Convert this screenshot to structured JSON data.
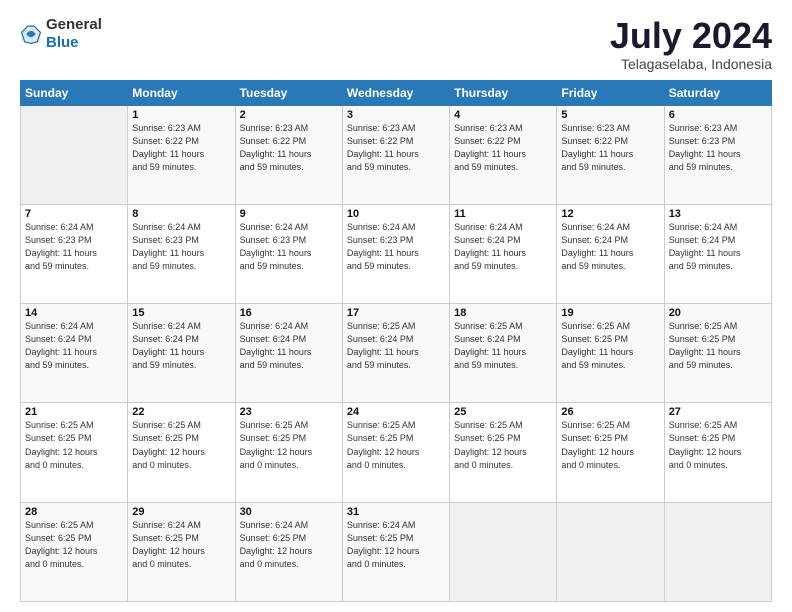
{
  "header": {
    "logo": {
      "general": "General",
      "blue": "Blue"
    },
    "title": "July 2024",
    "subtitle": "Telagaselaba, Indonesia"
  },
  "calendar": {
    "weekdays": [
      "Sunday",
      "Monday",
      "Tuesday",
      "Wednesday",
      "Thursday",
      "Friday",
      "Saturday"
    ],
    "weeks": [
      [
        {
          "day": "",
          "info": ""
        },
        {
          "day": "1",
          "info": "Sunrise: 6:23 AM\nSunset: 6:22 PM\nDaylight: 11 hours\nand 59 minutes."
        },
        {
          "day": "2",
          "info": "Sunrise: 6:23 AM\nSunset: 6:22 PM\nDaylight: 11 hours\nand 59 minutes."
        },
        {
          "day": "3",
          "info": "Sunrise: 6:23 AM\nSunset: 6:22 PM\nDaylight: 11 hours\nand 59 minutes."
        },
        {
          "day": "4",
          "info": "Sunrise: 6:23 AM\nSunset: 6:22 PM\nDaylight: 11 hours\nand 59 minutes."
        },
        {
          "day": "5",
          "info": "Sunrise: 6:23 AM\nSunset: 6:22 PM\nDaylight: 11 hours\nand 59 minutes."
        },
        {
          "day": "6",
          "info": "Sunrise: 6:23 AM\nSunset: 6:23 PM\nDaylight: 11 hours\nand 59 minutes."
        }
      ],
      [
        {
          "day": "7",
          "info": "Sunrise: 6:24 AM\nSunset: 6:23 PM\nDaylight: 11 hours\nand 59 minutes."
        },
        {
          "day": "8",
          "info": "Sunrise: 6:24 AM\nSunset: 6:23 PM\nDaylight: 11 hours\nand 59 minutes."
        },
        {
          "day": "9",
          "info": "Sunrise: 6:24 AM\nSunset: 6:23 PM\nDaylight: 11 hours\nand 59 minutes."
        },
        {
          "day": "10",
          "info": "Sunrise: 6:24 AM\nSunset: 6:23 PM\nDaylight: 11 hours\nand 59 minutes."
        },
        {
          "day": "11",
          "info": "Sunrise: 6:24 AM\nSunset: 6:24 PM\nDaylight: 11 hours\nand 59 minutes."
        },
        {
          "day": "12",
          "info": "Sunrise: 6:24 AM\nSunset: 6:24 PM\nDaylight: 11 hours\nand 59 minutes."
        },
        {
          "day": "13",
          "info": "Sunrise: 6:24 AM\nSunset: 6:24 PM\nDaylight: 11 hours\nand 59 minutes."
        }
      ],
      [
        {
          "day": "14",
          "info": "Sunrise: 6:24 AM\nSunset: 6:24 PM\nDaylight: 11 hours\nand 59 minutes."
        },
        {
          "day": "15",
          "info": "Sunrise: 6:24 AM\nSunset: 6:24 PM\nDaylight: 11 hours\nand 59 minutes."
        },
        {
          "day": "16",
          "info": "Sunrise: 6:24 AM\nSunset: 6:24 PM\nDaylight: 11 hours\nand 59 minutes."
        },
        {
          "day": "17",
          "info": "Sunrise: 6:25 AM\nSunset: 6:24 PM\nDaylight: 11 hours\nand 59 minutes."
        },
        {
          "day": "18",
          "info": "Sunrise: 6:25 AM\nSunset: 6:24 PM\nDaylight: 11 hours\nand 59 minutes."
        },
        {
          "day": "19",
          "info": "Sunrise: 6:25 AM\nSunset: 6:25 PM\nDaylight: 11 hours\nand 59 minutes."
        },
        {
          "day": "20",
          "info": "Sunrise: 6:25 AM\nSunset: 6:25 PM\nDaylight: 11 hours\nand 59 minutes."
        }
      ],
      [
        {
          "day": "21",
          "info": "Sunrise: 6:25 AM\nSunset: 6:25 PM\nDaylight: 12 hours\nand 0 minutes."
        },
        {
          "day": "22",
          "info": "Sunrise: 6:25 AM\nSunset: 6:25 PM\nDaylight: 12 hours\nand 0 minutes."
        },
        {
          "day": "23",
          "info": "Sunrise: 6:25 AM\nSunset: 6:25 PM\nDaylight: 12 hours\nand 0 minutes."
        },
        {
          "day": "24",
          "info": "Sunrise: 6:25 AM\nSunset: 6:25 PM\nDaylight: 12 hours\nand 0 minutes."
        },
        {
          "day": "25",
          "info": "Sunrise: 6:25 AM\nSunset: 6:25 PM\nDaylight: 12 hours\nand 0 minutes."
        },
        {
          "day": "26",
          "info": "Sunrise: 6:25 AM\nSunset: 6:25 PM\nDaylight: 12 hours\nand 0 minutes."
        },
        {
          "day": "27",
          "info": "Sunrise: 6:25 AM\nSunset: 6:25 PM\nDaylight: 12 hours\nand 0 minutes."
        }
      ],
      [
        {
          "day": "28",
          "info": "Sunrise: 6:25 AM\nSunset: 6:25 PM\nDaylight: 12 hours\nand 0 minutes."
        },
        {
          "day": "29",
          "info": "Sunrise: 6:24 AM\nSunset: 6:25 PM\nDaylight: 12 hours\nand 0 minutes."
        },
        {
          "day": "30",
          "info": "Sunrise: 6:24 AM\nSunset: 6:25 PM\nDaylight: 12 hours\nand 0 minutes."
        },
        {
          "day": "31",
          "info": "Sunrise: 6:24 AM\nSunset: 6:25 PM\nDaylight: 12 hours\nand 0 minutes."
        },
        {
          "day": "",
          "info": ""
        },
        {
          "day": "",
          "info": ""
        },
        {
          "day": "",
          "info": ""
        }
      ]
    ]
  }
}
